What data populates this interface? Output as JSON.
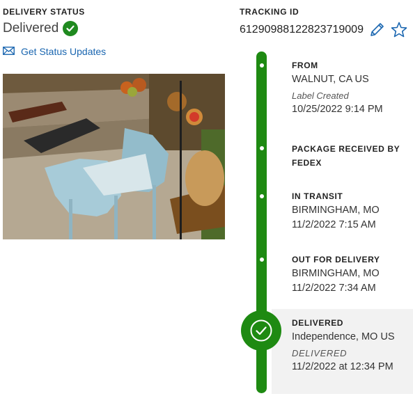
{
  "delivery": {
    "heading": "DELIVERY STATUS",
    "status": "Delivered",
    "updates_link": "Get Status Updates"
  },
  "tracking": {
    "heading": "TRACKING ID",
    "number": "61290988122823719009"
  },
  "events": {
    "from": {
      "title": "FROM",
      "location": "WALNUT, CA US",
      "note": "Label Created",
      "time": "10/25/2022 9:14 PM"
    },
    "received": {
      "title": "PACKAGE RECEIVED BY FEDEX"
    },
    "in_transit": {
      "title": "IN TRANSIT",
      "location": "BIRMINGHAM, MO",
      "time": "11/2/2022 7:15 AM"
    },
    "out_for_delivery": {
      "title": "OUT FOR DELIVERY",
      "location": "BIRMINGHAM, MO",
      "time": "11/2/2022 7:34 AM"
    },
    "delivered": {
      "title": "DELIVERED",
      "location": "Independence, MO US",
      "note": "DELIVERED",
      "time": "11/2/2022 at 12:34 PM"
    }
  },
  "colors": {
    "accent": "#1e8a12",
    "link": "#1a66b0",
    "highlight_bg": "#f2f2f2"
  },
  "icons": [
    "check-circle-icon",
    "envelope-icon",
    "pencil-icon",
    "star-outline-icon"
  ]
}
